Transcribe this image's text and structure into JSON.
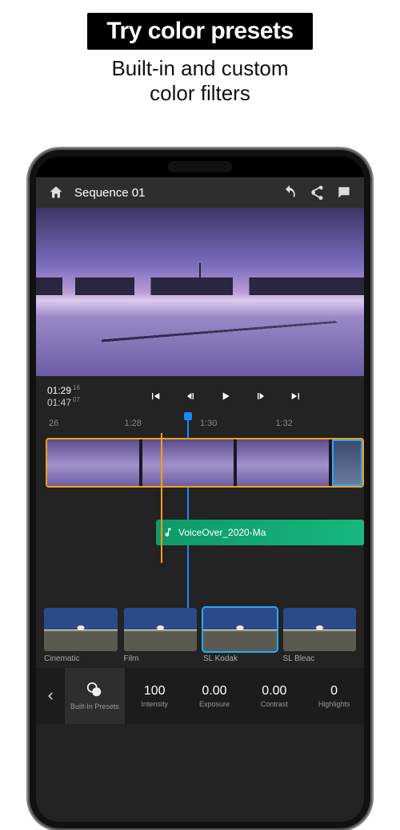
{
  "promo": {
    "title": "Try color presets",
    "subtitle_l1": "Built-in and custom",
    "subtitle_l2": "color filters"
  },
  "topbar": {
    "title": "Sequence 01"
  },
  "timecode": {
    "in": "01:29",
    "in_f": "16",
    "out": "01:47",
    "out_f": "07"
  },
  "ruler": {
    "t0": "26",
    "t1": "1:28",
    "t2": "1:30",
    "t3": "1:32"
  },
  "audio": {
    "clip_label": "VoiceOver_2020-Ma"
  },
  "presets": [
    {
      "label": "Cinematic",
      "selected": false
    },
    {
      "label": "Film",
      "selected": false
    },
    {
      "label": "SL Kodak",
      "selected": true
    },
    {
      "label": "SL Bleac",
      "selected": false
    }
  ],
  "params": {
    "builtin_label": "Built-In Presets",
    "items": [
      {
        "label": "Intensity",
        "value": "100"
      },
      {
        "label": "Exposure",
        "value": "0.00"
      },
      {
        "label": "Contrast",
        "value": "0.00"
      },
      {
        "label": "Highlights",
        "value": "0"
      }
    ]
  }
}
